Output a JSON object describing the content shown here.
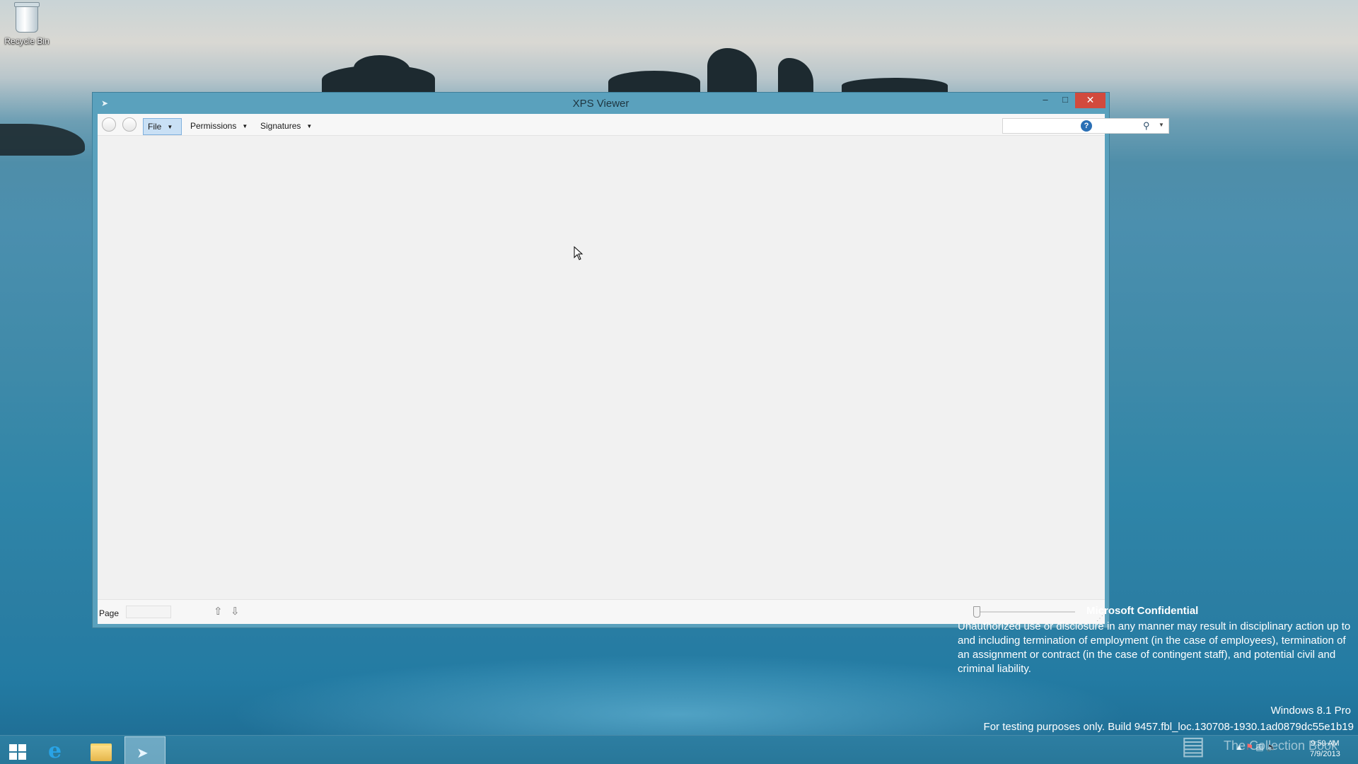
{
  "desktop": {
    "icons": [
      {
        "label": "Recycle Bin",
        "icon": "recycle-bin-icon"
      }
    ]
  },
  "window": {
    "title": "XPS Viewer",
    "controls": {
      "minimize": "–",
      "maximize": "□",
      "close": "✕"
    }
  },
  "toolbar": {
    "file_label": "File",
    "permissions_label": "Permissions",
    "signatures_label": "Signatures",
    "search": {
      "value": "",
      "placeholder": ""
    }
  },
  "statusbar": {
    "page_label": "Page",
    "page_value": ""
  },
  "watermark": {
    "title": "Microsoft Confidential",
    "body": "Unauthorized use or disclosure in any manner may result in disciplinary action up to and including termination of employment (in the case of employees), termination of an assignment or contract (in the case of contingent staff), and potential civil and criminal liability.",
    "edition": "Windows 8.1 Pro",
    "build": "For testing purposes only. Build 9457.fbl_loc.130708-1930.1ad0879dc55e1b19"
  },
  "taskbar": {
    "items": [
      "start-button",
      "internet-explorer-button",
      "file-explorer-button",
      "xps-viewer-button"
    ],
    "overlay_text": "The Collection Book",
    "time": "9:59 AM",
    "date": "7/9/2013"
  },
  "colors": {
    "title_bar": "#5aa1bd",
    "close_button": "#d24a3d",
    "file_menu_highlight": "#c9e0f5",
    "taskbar": "#2d7ea2"
  }
}
